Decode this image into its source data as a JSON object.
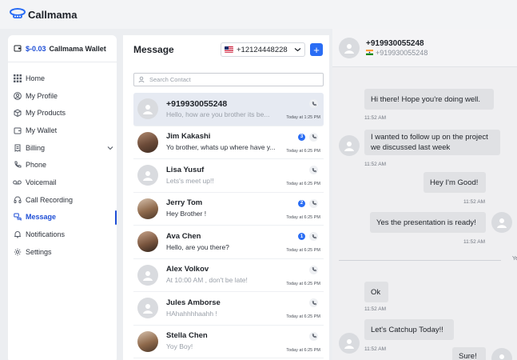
{
  "app": {
    "name": "Callmama"
  },
  "colors": {
    "accent": "#1f4fd6",
    "button": "#2a6df4",
    "badge": "#2a6df4"
  },
  "wallet": {
    "amount": "$-0.03",
    "label": "Callmama Wallet"
  },
  "nav": [
    {
      "label": "Home",
      "icon": "grid-icon"
    },
    {
      "label": "My Profile",
      "icon": "user-circle-icon"
    },
    {
      "label": "My Products",
      "icon": "box-icon"
    },
    {
      "label": "My Wallet",
      "icon": "wallet-icon"
    },
    {
      "label": "Billing",
      "icon": "receipt-icon",
      "expandable": true
    },
    {
      "label": "Phone",
      "icon": "phone-icon"
    },
    {
      "label": "Voicemail",
      "icon": "voicemail-icon"
    },
    {
      "label": "Call Recording",
      "icon": "headset-icon"
    },
    {
      "label": "Message",
      "icon": "chat-icon",
      "active": true
    },
    {
      "label": "Notifications",
      "icon": "bell-icon"
    },
    {
      "label": "Settings",
      "icon": "gear-icon"
    }
  ],
  "messages": {
    "title": "Message",
    "number": "+12124448228",
    "search_placeholder": "Search Contact",
    "contacts": [
      {
        "name": "+919930055248",
        "preview": "Hello, how are you brother its be...",
        "time": "Today at 1:25 PM",
        "muted": true,
        "active": true
      },
      {
        "name": "Jim Kakashi",
        "preview": "Yo brother, whats up where have y...",
        "time": "Today at 6:25 PM",
        "badge": "3",
        "photo": true
      },
      {
        "name": "Lisa Yusuf",
        "preview": "Lets's meet up!!",
        "time": "Today at 6:25 PM",
        "muted": true
      },
      {
        "name": "Jerry Tom",
        "preview": "Hey Brother !",
        "time": "Today at 6:25 PM",
        "badge": "2",
        "photo": true
      },
      {
        "name": "Ava Chen",
        "preview": "Hello, are you there?",
        "time": "Today at 6:25 PM",
        "badge": "1",
        "photo": true
      },
      {
        "name": "Alex Volkov",
        "preview": "At 10:00 AM , don't be late!",
        "time": "Today at 6:25 PM",
        "muted": true
      },
      {
        "name": "Jules Amborse",
        "preview": "HAhahhhhaahh !",
        "time": "Today at 6:25 PM",
        "muted": true
      },
      {
        "name": "Stella Chen",
        "preview": "Yoy Boy!",
        "time": "Today at 6:25 PM",
        "muted": true,
        "photo": true
      }
    ]
  },
  "chat": {
    "name": "+919930055248",
    "subtitle": "+919930055248",
    "divider_label": "Ye",
    "messages": [
      {
        "text": "Hi there! Hope you're doing well.",
        "time": "11:52 AM",
        "side": "in"
      },
      {
        "text": "I wanted to follow up on the project we discussed last week",
        "time": "11:52 AM",
        "side": "in"
      },
      {
        "text": "Hey I'm Good!",
        "time": "11:52 AM",
        "side": "out"
      },
      {
        "text": "Yes the presentation is ready!",
        "time": "11:52 AM",
        "side": "out"
      },
      {
        "text": "Ok",
        "time": "11:52 AM",
        "side": "in"
      },
      {
        "text": "Let's Catchup Today!!",
        "time": "11:52 AM",
        "side": "in"
      },
      {
        "text": "Sure!",
        "time": "",
        "side": "out"
      }
    ]
  }
}
